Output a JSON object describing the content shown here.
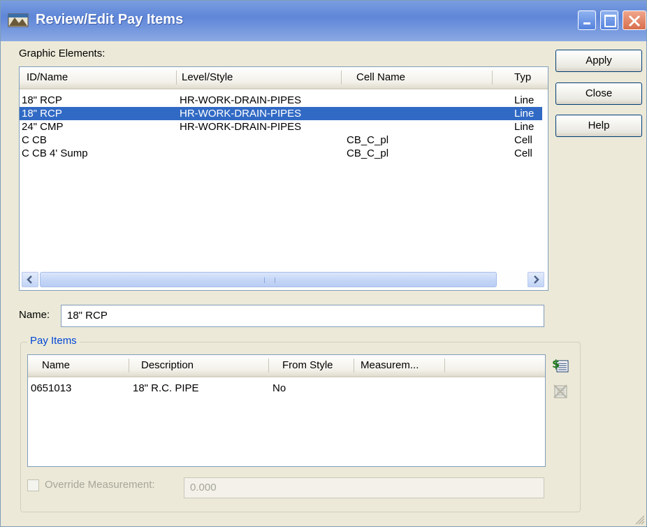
{
  "window": {
    "title": "Review/Edit Pay Items"
  },
  "graphic_elements": {
    "label": "Graphic Elements:",
    "columns": [
      "ID/Name",
      "Level/Style",
      "Cell Name",
      "Typ"
    ],
    "rows": [
      [
        "18\" RCP",
        "HR-WORK-DRAIN-PIPES",
        "",
        "Line"
      ],
      [
        "18\" RCP",
        "HR-WORK-DRAIN-PIPES",
        "",
        "Line"
      ],
      [
        "24\" CMP",
        "HR-WORK-DRAIN-PIPES",
        "",
        "Line"
      ],
      [
        "C CB",
        "",
        "CB_C_pl",
        "Cell"
      ],
      [
        "C CB 4' Sump",
        "",
        "CB_C_pl",
        "Cell"
      ]
    ],
    "selected_row": 1
  },
  "buttons": {
    "apply": "Apply",
    "close": "Close",
    "help": "Help"
  },
  "name_field": {
    "label": "Name:",
    "value": "18\" RCP"
  },
  "pay_items": {
    "label": "Pay Items",
    "columns": [
      "Name",
      "Description",
      "From Style",
      "Measurem..."
    ],
    "rows": [
      [
        "0651013",
        "18\" R.C. PIPE",
        "No",
        ""
      ]
    ]
  },
  "override": {
    "label": "Override Measurement:",
    "value": "0.000",
    "checked": false
  },
  "icons": {
    "add_pay_item": "add-pay-item-icon",
    "remove_pay_item": "remove-pay-item-icon"
  }
}
